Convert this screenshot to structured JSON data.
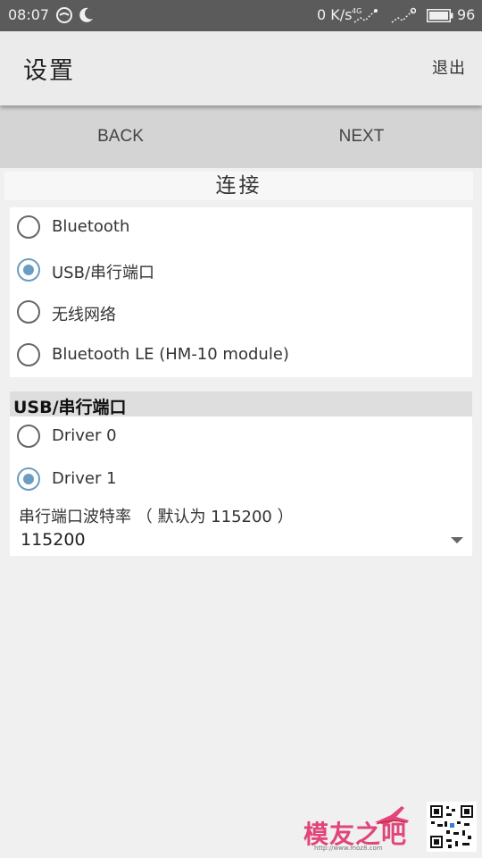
{
  "status_bar": {
    "time": "08:07",
    "network_speed": "0 K/s",
    "battery": "96",
    "icons": [
      "eye-comfort-icon",
      "moon-icon",
      "4g-signal-icon",
      "signal-icon",
      "battery-icon"
    ]
  },
  "app_bar": {
    "title": "设置",
    "exit_label": "退出"
  },
  "nav": {
    "back_label": "BACK",
    "next_label": "NEXT"
  },
  "connection": {
    "heading": "连接",
    "options": [
      {
        "label": "Bluetooth",
        "checked": false
      },
      {
        "label": "USB/串行端口",
        "checked": true
      },
      {
        "label": "无线网络",
        "checked": false
      },
      {
        "label": "Bluetooth LE (HM-10 module)",
        "checked": false
      }
    ]
  },
  "usb_section": {
    "heading": "USB/串行端口",
    "drivers": [
      {
        "label": "Driver 0",
        "checked": false
      },
      {
        "label": "Driver 1",
        "checked": true
      }
    ],
    "baud_label": "串行端口波特率 （ 默认为 115200 ）",
    "baud_value": "115200"
  },
  "watermark": {
    "text": "模友之吧",
    "url": "http://www.moz8.com"
  },
  "colors": {
    "accent": "#6b9dc2",
    "status_bar": "#5b5b5b",
    "nav_bar": "#d4d4d4",
    "watermark": "#e0457b"
  }
}
